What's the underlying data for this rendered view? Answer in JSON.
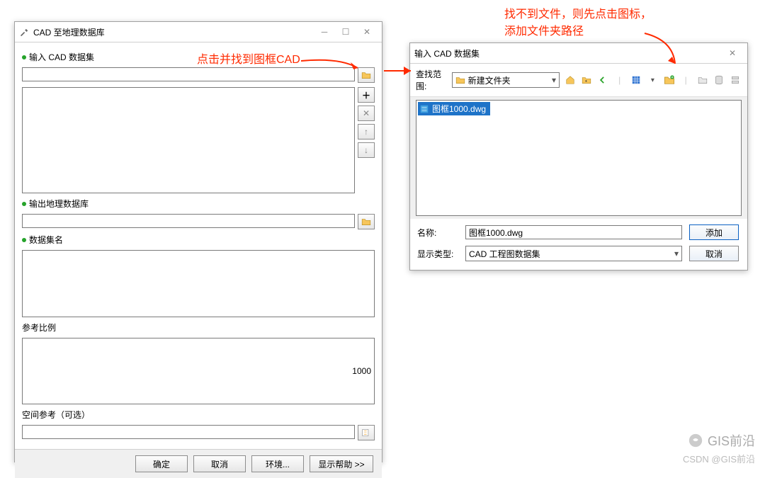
{
  "dlg1": {
    "title": "CAD 至地理数据库",
    "input_label": "输入 CAD 数据集",
    "output_label": "输出地理数据库",
    "dataset_label": "数据集名",
    "ratio_label": "参考比例",
    "ratio_value": "1000",
    "spatial_label": "空间参考（可选）",
    "ok": "确定",
    "cancel": "取消",
    "env": "环境...",
    "help": "显示帮助 >>"
  },
  "dlg2": {
    "title": "输入 CAD 数据集",
    "scope_label": "查找范围:",
    "scope_value": "新建文件夹",
    "file_selected": "图框1000.dwg",
    "name_label": "名称:",
    "name_value": "图框1000.dwg",
    "type_label": "显示类型:",
    "type_value": "CAD 工程图数据集",
    "add": "添加",
    "cancel": "取消"
  },
  "annotations": {
    "a1": "点击并找到图框CAD",
    "a2_line1": "找不到文件，则先点击图标，",
    "a2_line2": "添加文件夹路径"
  },
  "watermark": {
    "brand": "GIS前沿",
    "credit": "CSDN @GIS前沿"
  }
}
